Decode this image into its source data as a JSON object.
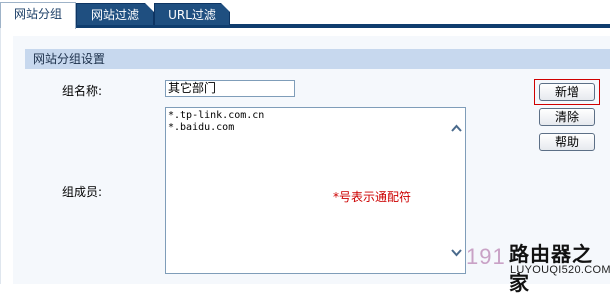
{
  "tabs": [
    {
      "label": "网站分组",
      "active": true
    },
    {
      "label": "网站过滤",
      "active": false
    },
    {
      "label": "URL过滤",
      "active": false
    }
  ],
  "section_title": "网站分组设置",
  "form": {
    "group_name_label": "组名称:",
    "group_name_value": "其它部门",
    "members_label": "组成员:",
    "members": [
      "*.tp-link.com.cn",
      "*.baidu.com"
    ],
    "hint": "*号表示通配符"
  },
  "buttons": {
    "add": "新增",
    "clear": "清除",
    "help": "帮助"
  },
  "watermark": {
    "number": "191",
    "brand": "路由器之家",
    "url": "LUYOUQI520.COM"
  },
  "colors": {
    "tab_bg": "#1f4f80",
    "section_header_bg": "#c7d8ee",
    "hint_text": "#cc0000",
    "focus_border": "#d00000"
  }
}
